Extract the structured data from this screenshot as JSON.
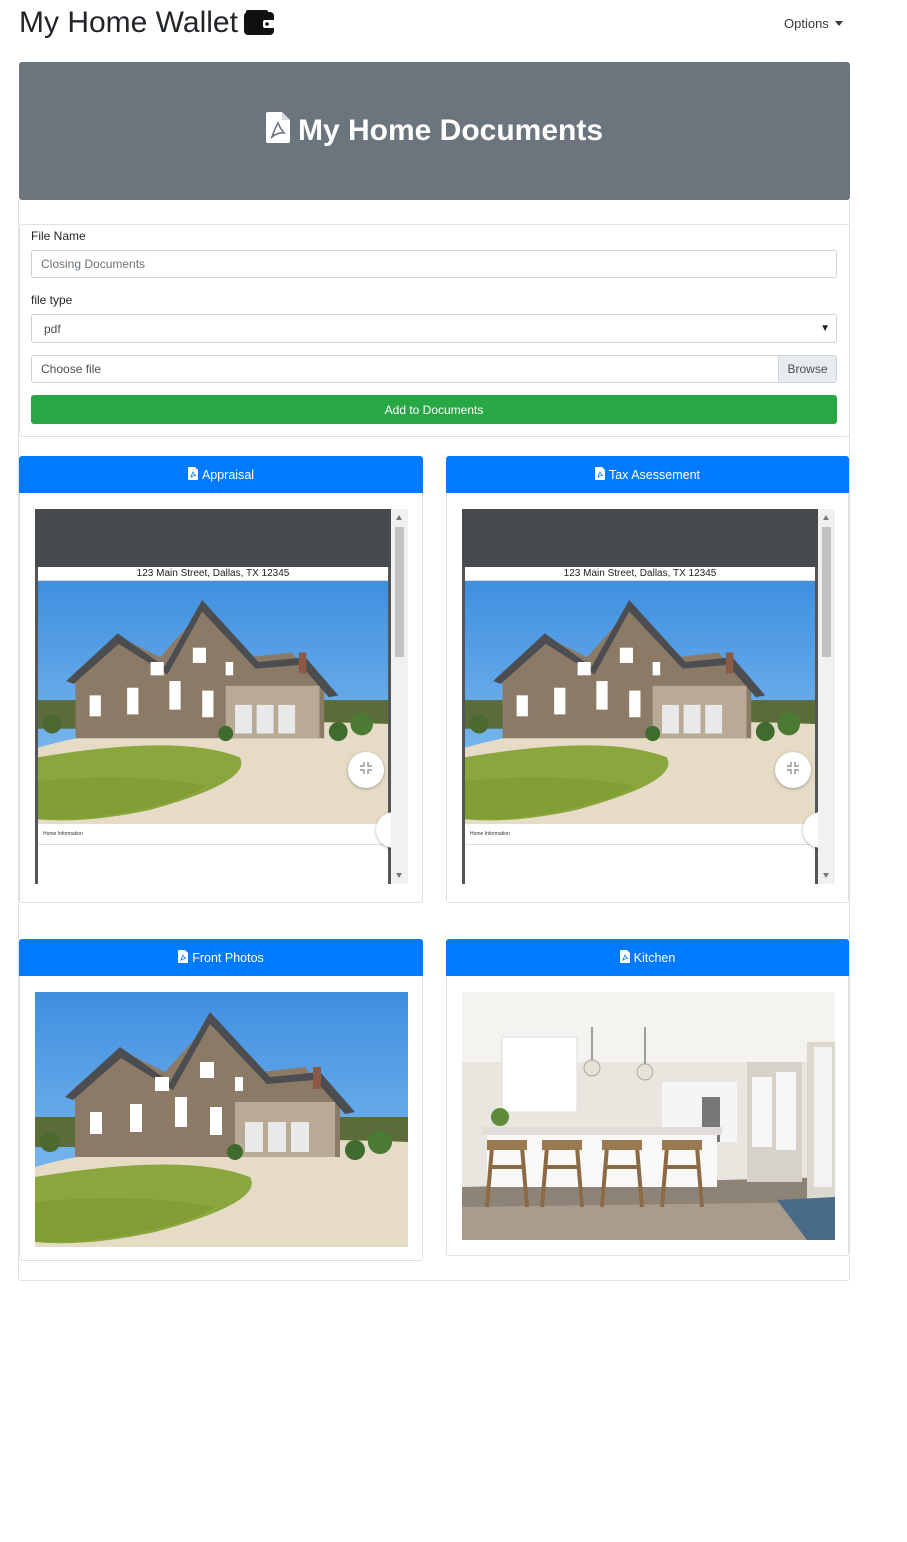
{
  "header": {
    "title": "My Home Wallet",
    "title_icon": "wallet-icon",
    "options_label": "Options"
  },
  "hero": {
    "title": "My Home Documents",
    "icon": "file-pdf-icon",
    "bg_color": "#6c757d"
  },
  "form": {
    "file_name_label": "File Name",
    "file_name_placeholder": "Closing Documents",
    "file_type_label": "file type",
    "file_type_selected": "pdf",
    "choose_file_label": "Choose file",
    "browse_label": "Browse",
    "add_button_label": "Add to Documents",
    "add_button_color": "#28a745"
  },
  "documents": [
    {
      "title": "Appraisal",
      "icon": "file-pdf-icon",
      "kind": "pdf",
      "address": "123 Main Street, Dallas, TX 12345",
      "section_label": "Home Information",
      "zoom_label": "-"
    },
    {
      "title": "Tax Asessement",
      "icon": "file-pdf-icon",
      "kind": "pdf",
      "address": "123 Main Street, Dallas, TX 12345",
      "section_label": "Home Information",
      "zoom_label": "-"
    },
    {
      "title": "Front Photos",
      "icon": "file-pdf-icon",
      "kind": "image",
      "image": "house-photo"
    },
    {
      "title": "Kitchen",
      "icon": "file-pdf-icon",
      "kind": "image",
      "image": "kitchen-photo"
    }
  ],
  "colors": {
    "card_header": "#007bff",
    "viewer_bg": "#525659"
  }
}
